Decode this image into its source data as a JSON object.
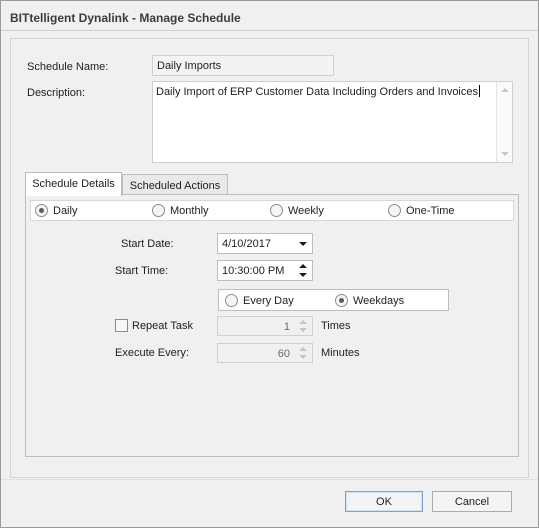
{
  "window": {
    "title": "BITtelligent Dynalink - Manage Schedule"
  },
  "form": {
    "schedule_name_label": "Schedule Name:",
    "schedule_name_value": "Daily Imports",
    "description_label": "Description:",
    "description_value": "Daily Import of ERP Customer Data Including Orders and Invoices"
  },
  "tabs": [
    {
      "label": "Schedule Details",
      "active": true
    },
    {
      "label": "Scheduled Actions",
      "active": false
    }
  ],
  "frequency": {
    "options": [
      {
        "label": "Daily",
        "selected": true
      },
      {
        "label": "Monthly",
        "selected": false
      },
      {
        "label": "Weekly",
        "selected": false
      },
      {
        "label": "One-Time",
        "selected": false
      }
    ]
  },
  "details": {
    "start_date_label": "Start Date:",
    "start_date_value": "4/10/2017",
    "start_time_label": "Start Time:",
    "start_time_value": "10:30:00 PM",
    "day_options": [
      {
        "label": "Every Day",
        "selected": false
      },
      {
        "label": "Weekdays",
        "selected": true
      }
    ],
    "repeat_task_label": "Repeat Task",
    "repeat_task_checked": false,
    "repeat_times_value": "1",
    "repeat_times_unit": "Times",
    "execute_every_label": "Execute Every:",
    "execute_every_value": "60",
    "execute_every_unit": "Minutes"
  },
  "buttons": {
    "ok": "OK",
    "cancel": "Cancel"
  }
}
